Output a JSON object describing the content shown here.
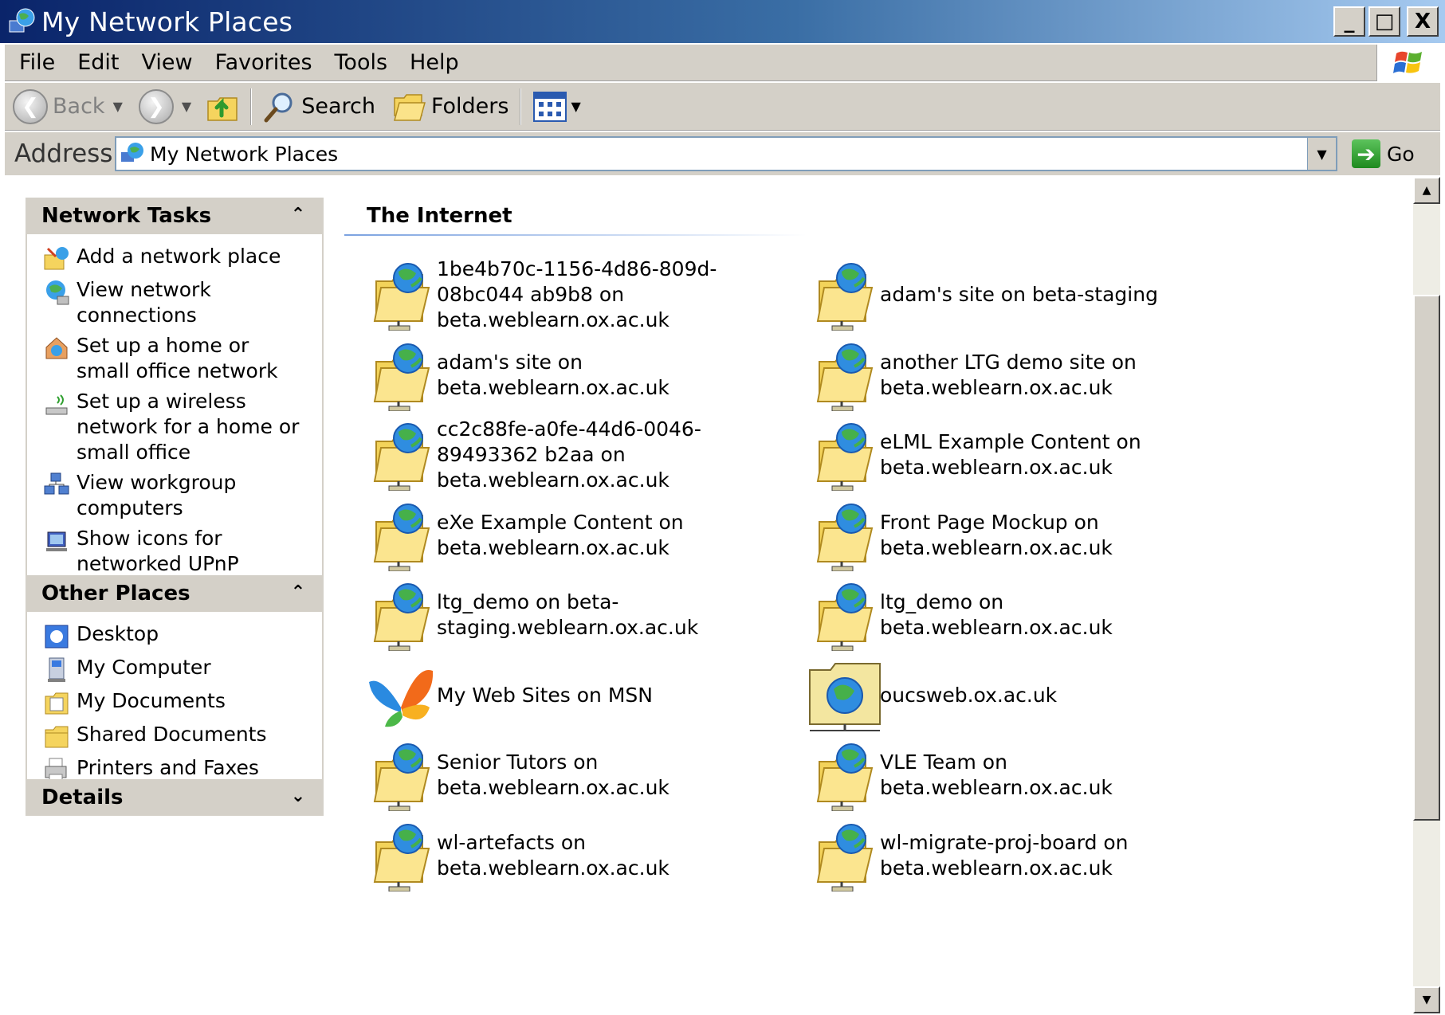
{
  "window": {
    "title": "My Network Places"
  },
  "window_buttons": {
    "minimize": "_",
    "maximize": "□",
    "close": "X"
  },
  "menu": [
    {
      "label": "File"
    },
    {
      "label": "Edit"
    },
    {
      "label": "View"
    },
    {
      "label": "Favorites"
    },
    {
      "label": "Tools"
    },
    {
      "label": "Help"
    }
  ],
  "toolbar": {
    "back_label": "Back",
    "search_label": "Search",
    "folders_label": "Folders"
  },
  "address": {
    "label": "Address",
    "value": "My Network Places",
    "go_label": "Go"
  },
  "network_tasks": {
    "title": "Network Tasks",
    "items": [
      {
        "label": "Add a network place",
        "icon": "add-network-place-icon"
      },
      {
        "label": "View network connections",
        "icon": "network-connections-icon"
      },
      {
        "label": "Set up a home or small office network",
        "icon": "home-network-icon"
      },
      {
        "label": "Set up a wireless network for a home or small office",
        "icon": "wireless-icon"
      },
      {
        "label": "View workgroup computers",
        "icon": "workgroup-icon"
      },
      {
        "label": "Show icons for networked UPnP devices",
        "icon": "upnp-icon"
      }
    ]
  },
  "other_places": {
    "title": "Other Places",
    "items": [
      {
        "label": "Desktop",
        "icon": "desktop-icon"
      },
      {
        "label": "My Computer",
        "icon": "my-computer-icon"
      },
      {
        "label": "My Documents",
        "icon": "my-documents-icon"
      },
      {
        "label": "Shared Documents",
        "icon": "shared-documents-icon"
      },
      {
        "label": "Printers and Faxes",
        "icon": "printer-icon"
      }
    ]
  },
  "details": {
    "title": "Details"
  },
  "group": {
    "title": "The Internet"
  },
  "places": [
    {
      "label": "1be4b70c-1156-4d86-809d-08bc044 ab9b8 on beta.weblearn.ox.ac.uk",
      "icon": "web-folder-icon"
    },
    {
      "label": "adam's site on beta-staging",
      "icon": "web-folder-icon"
    },
    {
      "label": "adam's site on beta.weblearn.ox.ac.uk",
      "icon": "web-folder-icon"
    },
    {
      "label": "another LTG demo site on beta.weblearn.ox.ac.uk",
      "icon": "web-folder-icon"
    },
    {
      "label": "cc2c88fe-a0fe-44d6-0046-89493362 b2aa on beta.weblearn.ox.ac.uk",
      "icon": "web-folder-icon"
    },
    {
      "label": "eLML Example Content on beta.weblearn.ox.ac.uk",
      "icon": "web-folder-icon"
    },
    {
      "label": "eXe Example Content on beta.weblearn.ox.ac.uk",
      "icon": "web-folder-icon"
    },
    {
      "label": "Front Page Mockup on beta.weblearn.ox.ac.uk",
      "icon": "web-folder-icon"
    },
    {
      "label": "ltg_demo on beta-staging.weblearn.ox.ac.uk",
      "icon": "web-folder-icon"
    },
    {
      "label": "ltg_demo on beta.weblearn.ox.ac.uk",
      "icon": "web-folder-icon"
    },
    {
      "label": "My Web Sites on MSN",
      "icon": "msn-butterfly-icon"
    },
    {
      "label": "oucsweb.ox.ac.uk",
      "icon": "network-folder-globe-icon"
    },
    {
      "label": "Senior Tutors on beta.weblearn.ox.ac.uk",
      "icon": "web-folder-icon"
    },
    {
      "label": "VLE Team on beta.weblearn.ox.ac.uk",
      "icon": "web-folder-icon"
    },
    {
      "label": "wl-artefacts on beta.weblearn.ox.ac.uk",
      "icon": "web-folder-icon"
    },
    {
      "label": "wl-migrate-proj-board on beta.weblearn.ox.ac.uk",
      "icon": "web-folder-icon"
    }
  ],
  "colors": {
    "titlebar_start": "#0a246a",
    "titlebar_end": "#a6caf0",
    "chrome": "#d4d0c8",
    "group_line": "#7ba2e0"
  }
}
